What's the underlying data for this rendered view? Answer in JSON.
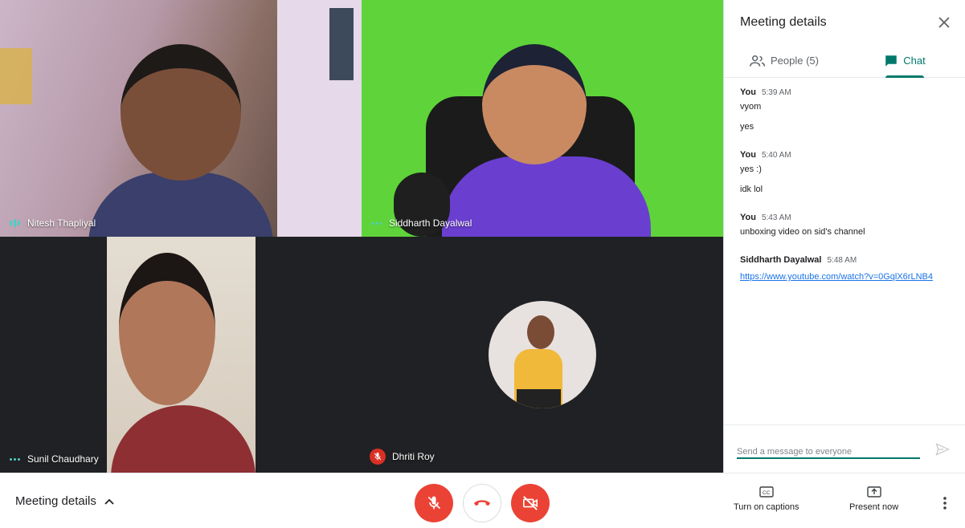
{
  "participants": [
    {
      "name": "Nitesh Thapliyal",
      "status": "speaking"
    },
    {
      "name": "Siddharth Dayalwal",
      "status": "active"
    },
    {
      "name": "Sunil Chaudhary",
      "status": "active"
    },
    {
      "name": "Dhriti Roy",
      "status": "muted"
    }
  ],
  "tile_labels": {
    "nitesh": "Nitesh Thapliyal",
    "sid": "Siddharth Dayalwal",
    "sunil": "Sunil Chaudhary",
    "dhriti": "Dhriti Roy"
  },
  "panel": {
    "title": "Meeting details",
    "tabs": {
      "people": "People (5)",
      "chat": "Chat"
    },
    "messages": [
      {
        "sender": "You",
        "time": "5:39 AM",
        "lines": [
          "vyom",
          "yes"
        ]
      },
      {
        "sender": "You",
        "time": "5:40 AM",
        "lines": [
          "yes :)",
          "idk lol"
        ]
      },
      {
        "sender": "You",
        "time": "5:43 AM",
        "lines": [
          "unboxing video on sid's channel"
        ]
      },
      {
        "sender": "Siddharth Dayalwal",
        "time": "5:48 AM",
        "link": "https://www.youtube.com/watch?v=0GqlX6rLNB4"
      }
    ],
    "composer_placeholder": "Send a message to everyone"
  },
  "bottom": {
    "meeting_details_label": "Meeting details",
    "captions_label": "Turn on captions",
    "present_label": "Present now"
  },
  "colors": {
    "accent": "#00796b",
    "danger": "#ea4335",
    "link": "#1a73e8",
    "speaking": "#4ecdc4"
  },
  "icons": [
    "close-icon",
    "people-icon",
    "chat-icon",
    "send-icon",
    "chevron-up-icon",
    "mic-off-icon",
    "end-call-icon",
    "camera-off-icon",
    "captions-icon",
    "present-icon",
    "more-vert-icon"
  ]
}
